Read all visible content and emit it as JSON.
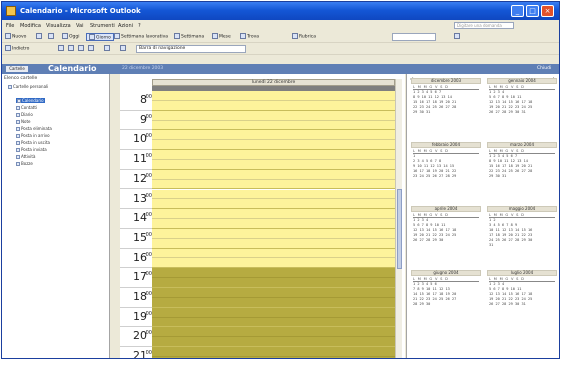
{
  "window": {
    "title": "Calendario - Microsoft Outlook",
    "minimize": "_",
    "maximize": "□",
    "close": "×"
  },
  "menu": [
    "File",
    "Modifica",
    "Visualizza",
    "Vai",
    "Strumenti",
    "Azioni",
    "?"
  ],
  "help_placeholder": "Digitare una domanda",
  "toolbar1": {
    "new_label": "Nuovo",
    "today_label": "Oggi",
    "day_label": "Giorno",
    "workweek_label": "Settimana lavorativa",
    "week_label": "Settimana",
    "month_label": "Mese",
    "find_label": "Trova",
    "address_book_label": "Rubrica"
  },
  "toolbar2": {
    "back_label": "Indietro",
    "combo_value": "Barra di navigazione"
  },
  "bluebar": {
    "folders_label": "Cartelle",
    "title": "Calendario",
    "date": "22 dicembre 2003",
    "close_label": "Chiudi"
  },
  "folder_pane": {
    "header": "Elenco cartelle",
    "items": [
      "Cartelle personali",
      "Calendario",
      "Contatti",
      "Diario",
      "Note",
      "Posta eliminata",
      "Posta in arrivo",
      "Posta in uscita",
      "Posta inviata",
      "Attività",
      "Bozze"
    ]
  },
  "day_view": {
    "header": "lunedì 22 dicembre",
    "hours": [
      "8",
      "9",
      "10",
      "11",
      "12",
      "13",
      "14",
      "15",
      "16",
      "17",
      "18",
      "19",
      "20",
      "21"
    ],
    "minutes": "00",
    "work_start_hour": 8,
    "work_end_hour": 17
  },
  "mini_calendars": {
    "dow": "L M M G V S D",
    "months": [
      {
        "title": "dicembre 2003",
        "weeks": [
          "1 2 3 4 5 6 7",
          "8 9 10 11 12 13 14",
          "15 16 17 18 19 20 21",
          "22 23 24 25 26 27 28",
          "29 30 31"
        ]
      },
      {
        "title": "gennaio 2004",
        "weeks": [
          "1 2 3 4",
          "5 6 7 8 9 10 11",
          "12 13 14 15 16 17 18",
          "19 20 21 22 23 24 25",
          "26 27 28 29 30 31"
        ]
      },
      {
        "title": "febbraio 2004",
        "weeks": [
          "1",
          "2 3 4 5 6 7 8",
          "9 10 11 12 13 14 15",
          "16 17 18 19 20 21 22",
          "23 24 25 26 27 28 29"
        ]
      },
      {
        "title": "marzo 2004",
        "weeks": [
          "1 2 3 4 5 6 7",
          "8 9 10 11 12 13 14",
          "15 16 17 18 19 20 21",
          "22 23 24 25 26 27 28",
          "29 30 31"
        ]
      },
      {
        "title": "aprile 2004",
        "weeks": [
          "1 2 3 4",
          "5 6 7 8 9 10 11",
          "12 13 14 15 16 17 18",
          "19 20 21 22 23 24 25",
          "26 27 28 29 30"
        ]
      },
      {
        "title": "maggio 2004",
        "weeks": [
          "1 2",
          "3 4 5 6 7 8 9",
          "10 11 12 13 14 15 16",
          "17 18 19 20 21 22 23",
          "24 25 26 27 28 29 30",
          "31"
        ]
      },
      {
        "title": "giugno 2004",
        "weeks": [
          "1 2 3 4 5 6",
          "7 8 9 10 11 12 13",
          "14 15 16 17 18 19 20",
          "21 22 23 24 25 26 27",
          "28 29 30"
        ]
      },
      {
        "title": "luglio 2004",
        "weeks": [
          "1 2 3 4",
          "5 6 7 8 9 10 11",
          "12 13 14 15 16 17 18",
          "19 20 21 22 23 24 25",
          "26 27 28 29 30 31"
        ]
      }
    ]
  }
}
